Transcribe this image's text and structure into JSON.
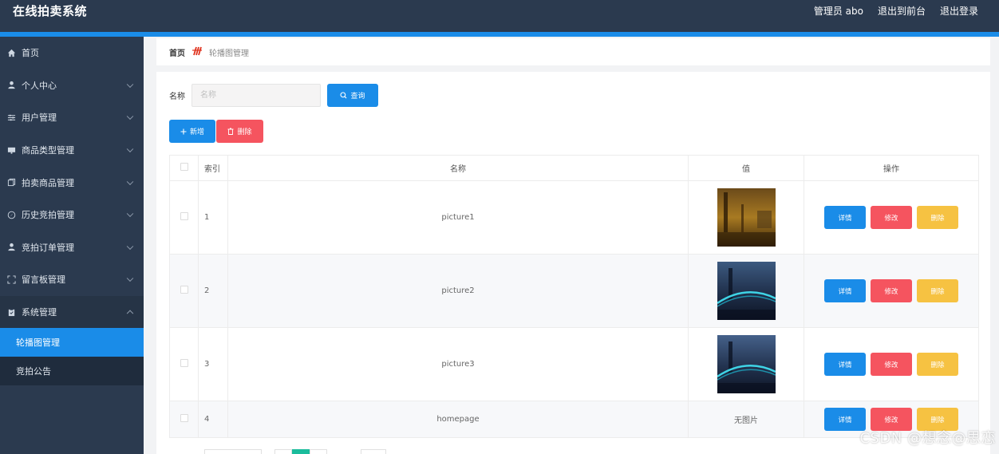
{
  "header": {
    "app_title": "在线拍卖系统",
    "user_label": "管理员 abo",
    "to_front_label": "退出到前台",
    "logout_label": "退出登录"
  },
  "sidebar": {
    "items": [
      {
        "label": "首页",
        "icon": "home-icon"
      },
      {
        "label": "个人中心",
        "icon": "user-icon"
      },
      {
        "label": "用户管理",
        "icon": "sliders-icon"
      },
      {
        "label": "商品类型管理",
        "icon": "monitor-icon"
      },
      {
        "label": "拍卖商品管理",
        "icon": "copy-icon"
      },
      {
        "label": "历史竞拍管理",
        "icon": "compass-icon"
      },
      {
        "label": "竞拍订单管理",
        "icon": "user-icon"
      },
      {
        "label": "留言板管理",
        "icon": "frame-icon"
      },
      {
        "label": "系统管理",
        "icon": "clipboard-icon"
      }
    ],
    "sub_items": [
      {
        "label": "轮播图管理",
        "active": true
      },
      {
        "label": "竞拍公告",
        "active": false
      }
    ]
  },
  "breadcrumb": {
    "home": "首页",
    "current": "轮播图管理"
  },
  "search": {
    "label": "名称",
    "placeholder": "名称",
    "button_label": "查询"
  },
  "toolbar": {
    "add_label": "新增",
    "delete_label": "删除"
  },
  "table": {
    "columns": [
      "索引",
      "名称",
      "值",
      "操作"
    ],
    "rows": [
      {
        "index": "1",
        "name": "picture1",
        "value": "image"
      },
      {
        "index": "2",
        "name": "picture2",
        "value": "image"
      },
      {
        "index": "3",
        "name": "picture3",
        "value": "image"
      },
      {
        "index": "4",
        "name": "homepage",
        "value": "无图片"
      }
    ],
    "actions": {
      "detail": "详情",
      "edit": "修改",
      "delete": "删除"
    }
  },
  "watermark": "CSDN @想念@思恋",
  "colors": {
    "header_bg": "#2b3a4f",
    "accent": "#1a8ce8",
    "danger": "#f5545f",
    "warning": "#f6c242"
  }
}
